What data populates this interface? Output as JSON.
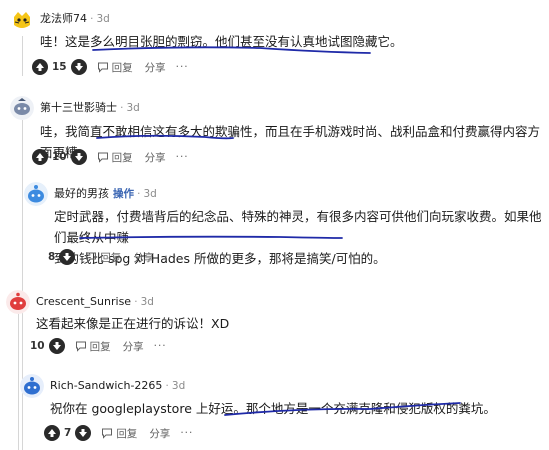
{
  "comments": [
    {
      "username": "龙法师74",
      "op_label": "",
      "age": "3d",
      "body": [
        "哇！这是多么明目张胆的剽窃。他们甚至没有认真地试图隐藏它。"
      ],
      "votes": "15",
      "reply": "回复",
      "share": "分享",
      "more": "···"
    },
    {
      "username": "第十三世影骑士",
      "op_label": "",
      "age": "3d",
      "body": [
        "哇，我简直不敢相信这有多大的欺骗性，而且在手机游戏时尚、战利品盒和付费赢得内容方面更糟。"
      ],
      "votes": "10",
      "reply": "回复",
      "share": "分享",
      "more": "···"
    },
    {
      "username": "最好的男孩",
      "op_label": "操作",
      "age": "3d",
      "body": [
        "定时武器，付费墙背后的纪念品、特殊的神灵，有很多内容可供他们向玩家收费。如果他们最终从中赚",
        "到的钱比 spg 对 Hades 所做的更多，那将是搞笑/可怕的。"
      ],
      "votes": "8",
      "reply": "回复",
      "share": "分享",
      "more": "···"
    },
    {
      "username": "Crescent_Sunrise",
      "op_label": "",
      "age": "3d",
      "body": [
        "这看起来像是正在进行的诉讼！XD"
      ],
      "votes": "10",
      "reply": "回复",
      "share": "分享",
      "more": "···"
    },
    {
      "username": "Rich-Sandwich-2265",
      "op_label": "",
      "age": "3d",
      "body": [
        "祝你在 googleplaystore 上好运。那个地方是一个充满克隆和侵犯版权的粪坑。"
      ],
      "votes": "7",
      "reply": "回复",
      "share": "分享",
      "more": "···"
    }
  ],
  "colors": {
    "annotation_ink": "#1f2aa8",
    "op_label": "#3b66b3",
    "vote_button": "#2a2a2a",
    "avatar_1": "#f5c518",
    "avatar_2": "#7a8aa8",
    "avatar_3": "#3d8be0",
    "avatar_4": "#e03d3d",
    "avatar_5": "#2f6fd0"
  },
  "icons": {
    "vote": "vote-arrow-icon",
    "reply": "speech-bubble-icon"
  }
}
